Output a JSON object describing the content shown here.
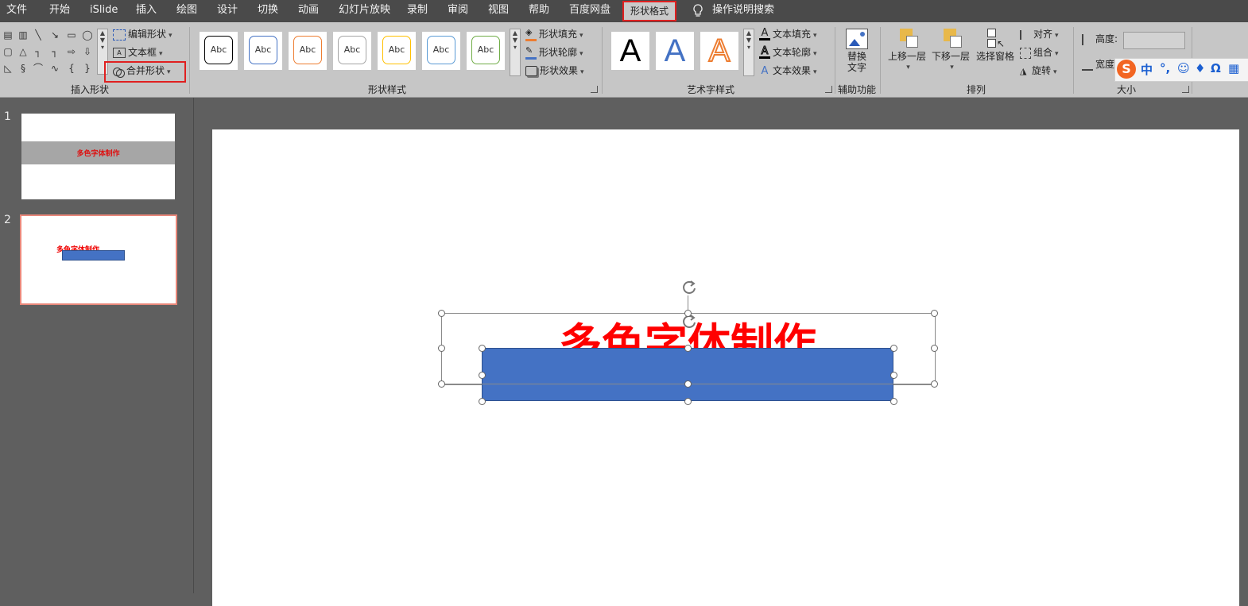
{
  "menu": {
    "tabs": [
      "文件",
      "开始",
      "iSlide",
      "插入",
      "绘图",
      "设计",
      "切换",
      "动画",
      "幻灯片放映",
      "录制",
      "审阅",
      "视图",
      "帮助",
      "百度网盘",
      "形状格式"
    ],
    "active_tab": "形状格式",
    "search_label": "操作说明搜索"
  },
  "ribbon": {
    "insert_shapes": {
      "label": "插入形状",
      "edit_shape": "编辑形状",
      "text_box": "文本框",
      "merge_shapes": "合并形状"
    },
    "shape_styles": {
      "label": "形状样式",
      "thumb_text": "Abc",
      "thumb_colors": [
        "#000000",
        "#4472c4",
        "#ed7d31",
        "#a5a5a5",
        "#ffc000",
        "#5b9bd5",
        "#70ad47"
      ],
      "fill": "形状填充",
      "outline": "形状轮廓",
      "effects": "形状效果"
    },
    "wordart": {
      "label": "艺术字样式",
      "sample_letter": "A",
      "text_fill": "文本填充",
      "text_outline": "文本轮廓",
      "text_effects": "文本效果"
    },
    "accessibility": {
      "label": "辅助功能",
      "alt_text_line1": "替换",
      "alt_text_line2": "文字"
    },
    "arrange": {
      "label": "排列",
      "bring_forward": "上移一层",
      "send_backward": "下移一层",
      "selection_pane": "选择窗格",
      "align": "对齐",
      "group": "组合",
      "rotate": "旋转"
    },
    "size": {
      "label": "大小",
      "height": "高度:",
      "width": "宽度"
    }
  },
  "ime": {
    "logo": "S",
    "mode": "中",
    "punct": "°,",
    "items": [
      "emoji-icon",
      "mic-icon",
      "omega-icon",
      "keyboard-icon"
    ]
  },
  "slides": [
    {
      "number": "1",
      "title": "多色字体制作"
    },
    {
      "number": "2",
      "title": "多色字体制作"
    }
  ],
  "canvas": {
    "title_text": "多色字体制作",
    "title_color": "#ff0000",
    "rect_color": "#4472c4"
  },
  "colors": {
    "highlight": "#e02020",
    "menu_bg": "#4a4a4a",
    "ribbon_bg": "#c6c6c6",
    "workspace_bg": "#5f5f5f"
  }
}
